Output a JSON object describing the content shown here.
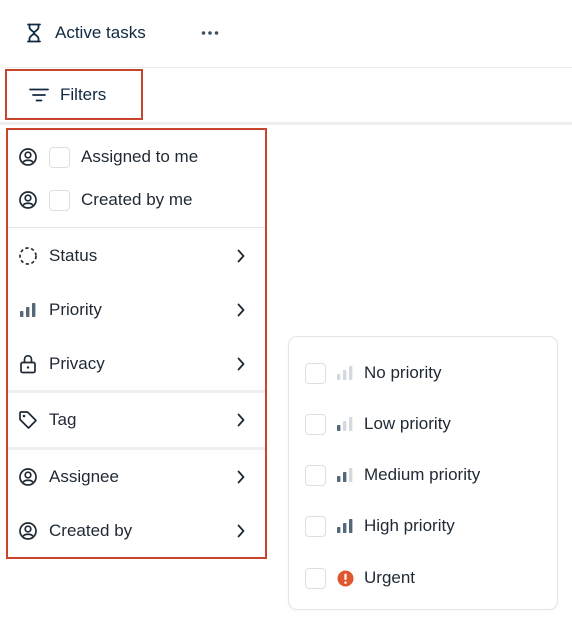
{
  "header": {
    "title": "Active tasks",
    "title_icon": "hourglass-icon",
    "more_icon": "more-horizontal-icon"
  },
  "filterbar": {
    "filters_label": "Filters",
    "filters_icon": "filter-lines-icon"
  },
  "filter_menu": {
    "quick": [
      {
        "label": "Assigned to me",
        "icon": "user-circle-icon",
        "checked": false
      },
      {
        "label": "Created by me",
        "icon": "user-circle-icon",
        "checked": false
      }
    ],
    "groups": [
      {
        "label": "Status",
        "icon": "dashed-circle-icon"
      },
      {
        "label": "Priority",
        "icon": "bar-chart-icon"
      },
      {
        "label": "Privacy",
        "icon": "lock-icon"
      },
      {
        "label": "Tag",
        "icon": "tag-icon"
      },
      {
        "label": "Assignee",
        "icon": "user-circle-icon"
      },
      {
        "label": "Created by",
        "icon": "user-circle-icon"
      }
    ]
  },
  "priority_submenu": {
    "items": [
      {
        "label": "No priority",
        "icon": "priority-none-icon",
        "checked": false
      },
      {
        "label": "Low priority",
        "icon": "priority-low-icon",
        "checked": false
      },
      {
        "label": "Medium priority",
        "icon": "priority-medium-icon",
        "checked": false
      },
      {
        "label": "High priority",
        "icon": "priority-high-icon",
        "checked": false
      },
      {
        "label": "Urgent",
        "icon": "urgent-icon",
        "checked": false
      }
    ]
  },
  "colors": {
    "highlight_border": "#c8452c",
    "urgent": "#e0572f",
    "bar_active": "#55687a",
    "bar_inactive": "#d3d9df"
  }
}
